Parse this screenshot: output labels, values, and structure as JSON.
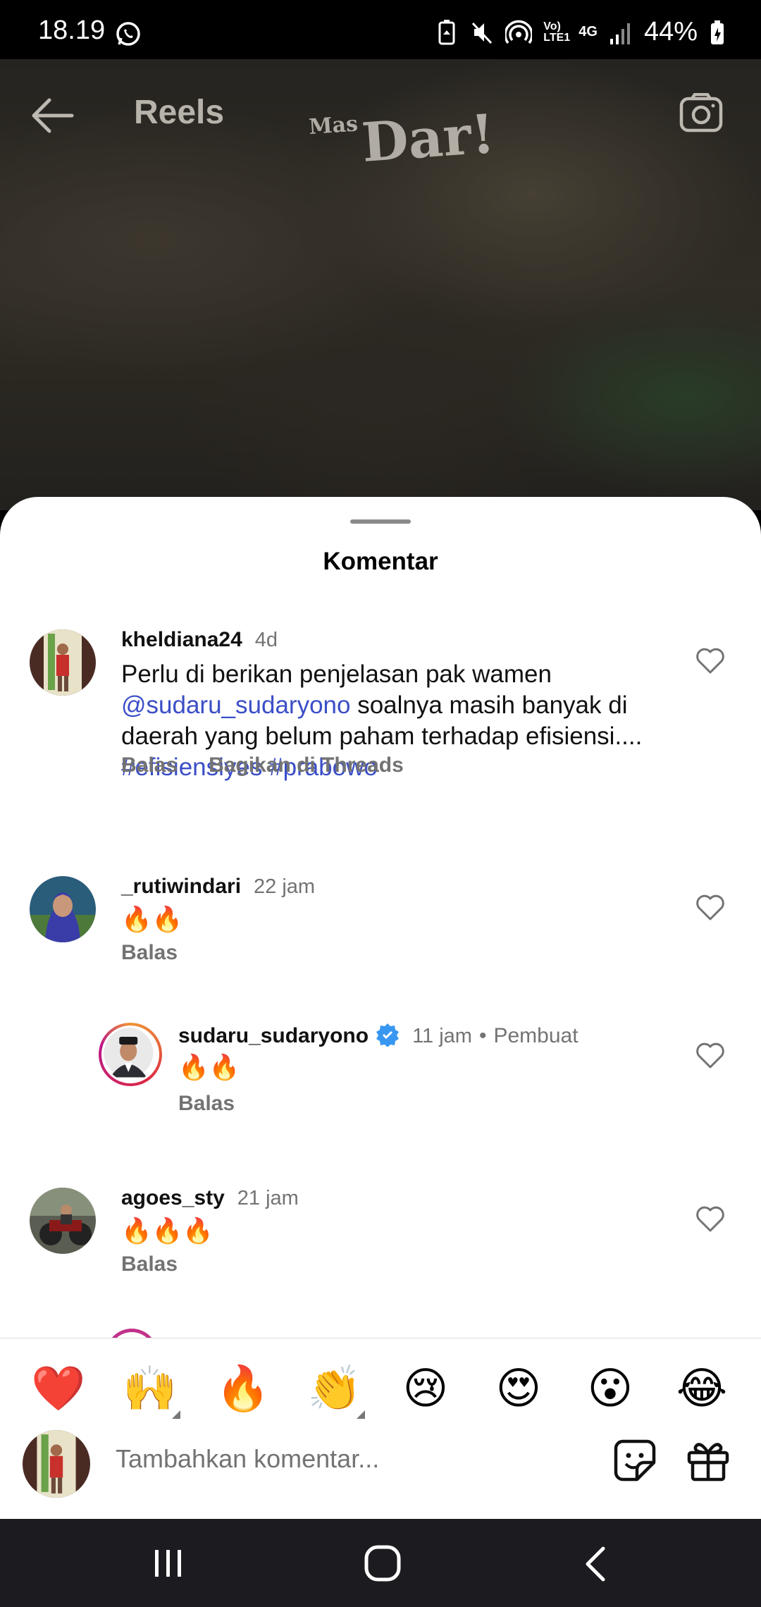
{
  "status_bar": {
    "time": "18.19",
    "battery": "44%",
    "icons": [
      "whatsapp-icon",
      "battery-saver-icon",
      "mute-icon",
      "hotspot-icon",
      "volte-icon",
      "4g-icon",
      "signal-icon",
      "battery-icon"
    ],
    "volte_label": "Vo) LTE1",
    "net_label": "4G"
  },
  "header": {
    "title": "Reels",
    "watermark_small": "Mas",
    "watermark": "Dar!"
  },
  "sheet": {
    "title": "Komentar"
  },
  "comments": [
    {
      "username": "kheldiana24",
      "time": "4d",
      "text_prefix": "Perlu di berikan penjelasan pak  wamen ",
      "mention": "@sudaru_sudaryono",
      "text_middle": "  soalnya masih banyak di daerah yang belum paham terhadap efisiensi.... ",
      "tag1": "#efisiensiyes",
      "tag2": "#prabowo",
      "reply": "Balas",
      "share": "Bagikan di Threads"
    },
    {
      "username": "_rutiwindari",
      "time": "22 jam",
      "text": "🔥🔥",
      "reply": "Balas"
    },
    {
      "username": "sudaru_sudaryono",
      "time": "11 jam",
      "badge": "Pembuat",
      "text": "🔥🔥",
      "reply": "Balas"
    },
    {
      "username": "agoes_sty",
      "time": "21 jam",
      "text": "🔥🔥🔥",
      "reply": "Balas"
    }
  ],
  "emoji_bar": [
    "❤️",
    "🙌",
    "🔥",
    "👏",
    "😢",
    "😍",
    "😮",
    "😂"
  ],
  "composer": {
    "placeholder": "Tambahkan komentar..."
  },
  "colors": {
    "link": "#3b4ec7",
    "muted": "#737373",
    "verified": "#3897f0"
  }
}
